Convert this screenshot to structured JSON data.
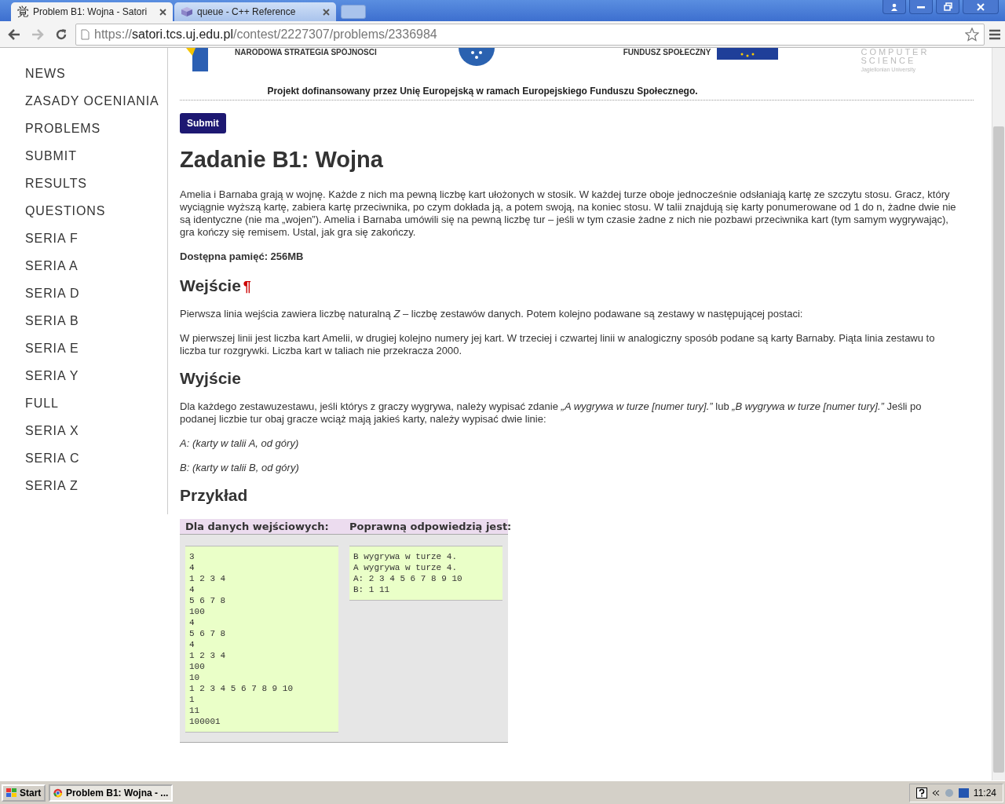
{
  "browser": {
    "tabs": [
      {
        "title": "Problem B1: Wojna - Satori",
        "selected": true,
        "kind": "kanji",
        "glyph": "覚"
      },
      {
        "title": "queue - C++ Reference",
        "selected": false,
        "kind": "cube"
      }
    ],
    "url": {
      "origin": "https://",
      "host": "satori.tcs.uj.edu.pl",
      "path": "/contest/2227307/problems/2336984"
    }
  },
  "sidebar": {
    "items": [
      "NEWS",
      "ZASADY OCENIANIA",
      "PROBLEMS",
      "SUBMIT",
      "RESULTS",
      "QUESTIONS",
      "SERIA F",
      "SERIA A",
      "SERIA D",
      "SERIA B",
      "SERIA E",
      "SERIA Y",
      "FULL",
      "SERIA X",
      "SERIA C",
      "SERIA Z"
    ]
  },
  "banner": {
    "logo_texts": [
      "NARODOWA STRATEGIA SPÓJNOSCI",
      "FUNDUSZ SPOŁECZNY"
    ],
    "cs_logo": [
      "COMPUTER",
      "SCIENCE",
      "Jagiellonian University"
    ],
    "caption": "Projekt dofinansowany przez Unię Europejską w ramach Europejskiego Funduszu Społecznego."
  },
  "submit_button": "Submit",
  "problem": {
    "title": "Zadanie B1: Wojna",
    "intro": "Amelia i Barnaba grają w wojnę. Każde z nich ma pewną liczbę kart ułożonych w stosik. W każdej turze oboje jednocześnie odsłaniają kartę ze szczytu stosu. Gracz, który wyciągnie wyższą kartę, zabiera kartę przeciwnika, po czym dokłada ją, a potem swoją, na koniec stosu. W talii znajdują się karty ponumerowane od 1 do n, żadne dwie nie są identyczne (nie ma „wojen”). Amelia i Barnaba umówili się na pewną liczbę tur – jeśli w tym czasie żadne z nich nie pozbawi przeciwnika kart (tym samym wygrywając), gra kończy się remisem. Ustal, jak gra się zakończy.",
    "memory": "Dostępna pamięć: 256MB",
    "sections": [
      {
        "heading": "Wejście",
        "anchor": "¶",
        "paragraphs": [
          "Pierwsza linia wejścia zawiera liczbę naturalną *Z* – liczbę zestawów danych. Potem kolejno podawane są zestawy w następującej postaci:",
          "W pierwszej linii jest liczba kart Amelii, w drugiej kolejno numery jej kart. W trzeciej i czwartej linii w analogiczny sposób podane są karty Barnaby. Piąta linia zestawu to liczba tur rozgrywki. Liczba kart w taliach nie przekracza 2000."
        ]
      },
      {
        "heading": "Wyjście",
        "paragraphs": [
          "Dla każdego zestawuzestawu, jeśli którys z graczy wygrywa, należy wypisać zdanie *„A wygrywa w turze [numer tury].”* lub *„B wygrywa w turze [numer tury].”* Jeśli po podanej liczbie tur obaj gracze wciąż mają jakieś karty, należy wypisać dwie linie:",
          "*A: (karty w talii A, od góry)*",
          "*B: (karty w talii B, od góry)*"
        ]
      }
    ],
    "example": {
      "heading": "Przykład",
      "input_label": "Dla danych wejściowych:",
      "output_label": "Poprawną odpowiedzią jest:",
      "input": [
        "3",
        "4",
        "1 2 3 4",
        "4",
        "5 6 7 8",
        "100",
        "4",
        "5 6 7 8",
        "4",
        "1 2 3 4",
        "100",
        "10",
        "1 2 3 4 5 6 7 8 9 10",
        "1",
        "11",
        "100001"
      ],
      "output": [
        "B wygrywa w turze 4.",
        "A wygrywa w turze 4.",
        "A: 2 3 4 5 6 7 8 9 10",
        "B: 1 11"
      ]
    }
  },
  "taskbar": {
    "start": "Start",
    "task": "Problem B1: Wojna - ...",
    "clock": "11:24"
  }
}
